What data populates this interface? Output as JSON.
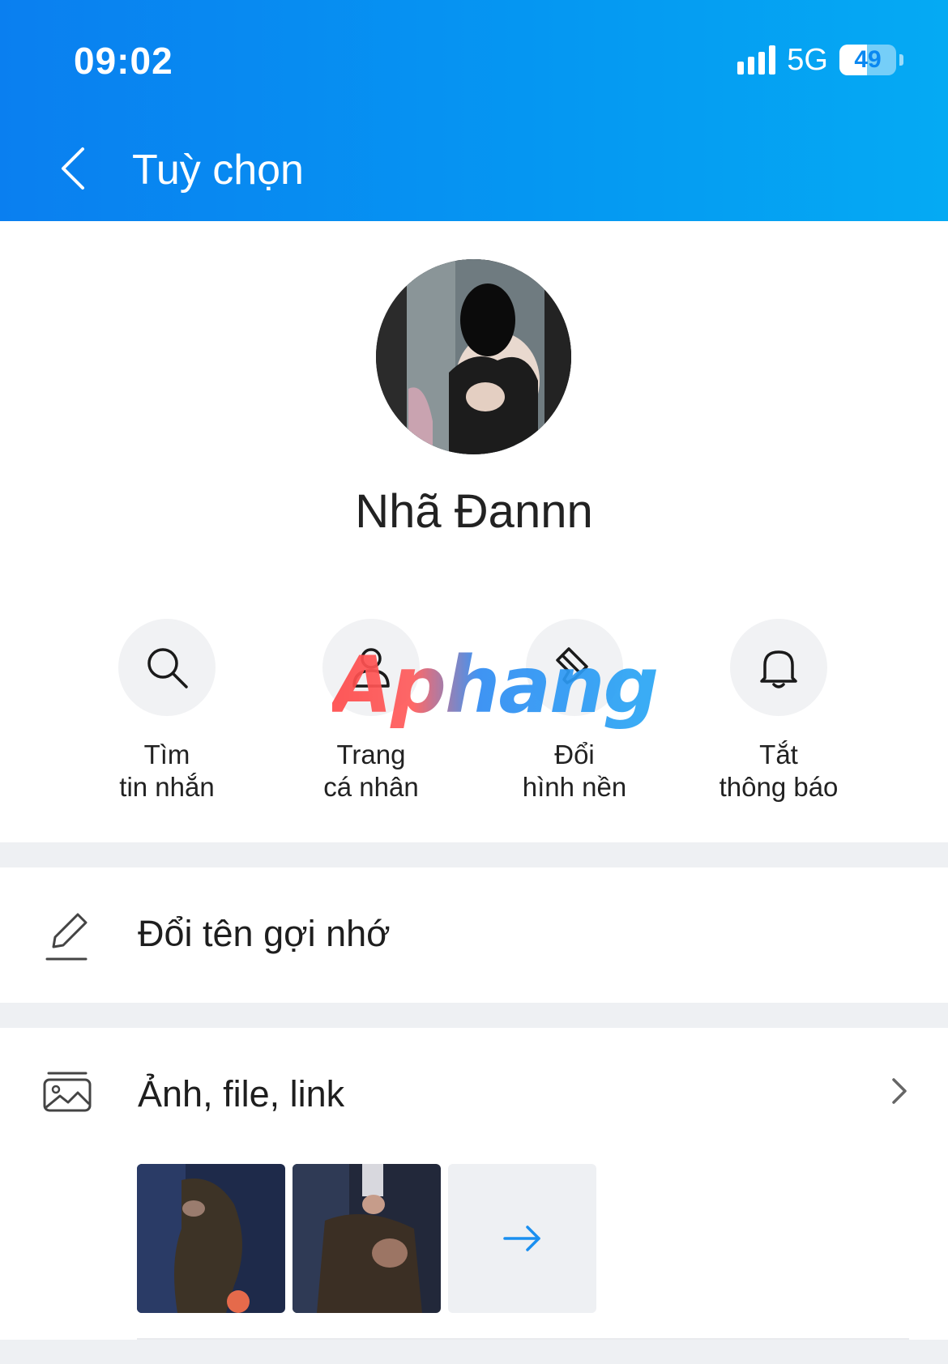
{
  "status_bar": {
    "time": "09:02",
    "network": "5G",
    "battery_level": "49",
    "battery_fraction": 0.49
  },
  "header": {
    "title": "Tuỳ chọn",
    "back_icon": "chevron-left-icon",
    "background_start": "#0a7ff0",
    "background_end": "#05aaf3"
  },
  "profile": {
    "name": "Nhã Đannn"
  },
  "quick_actions": [
    {
      "icon": "search-icon",
      "line1": "Tìm",
      "line2": "tin nhắn"
    },
    {
      "icon": "user-icon",
      "line1": "Trang",
      "line2": "cá nhân"
    },
    {
      "icon": "paint-brush-icon",
      "line1": "Đổi",
      "line2": "hình nền"
    },
    {
      "icon": "bell-icon",
      "line1": "Tắt",
      "line2": "thông báo"
    }
  ],
  "watermark": "Aphang",
  "menu": {
    "rename": {
      "icon": "pencil-icon",
      "label": "Đổi tên gợi nhớ"
    },
    "media": {
      "icon": "image-folder-icon",
      "label": "Ảnh, file, link",
      "chevron_icon": "chevron-right-icon"
    }
  },
  "media_preview": {
    "more_icon": "arrow-right-icon",
    "accent": "#1a8ff0"
  }
}
